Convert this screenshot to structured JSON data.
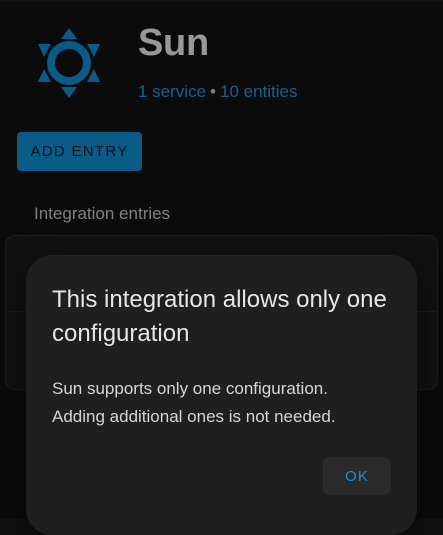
{
  "header": {
    "title": "Sun",
    "services_link": "1 service",
    "separator": "•",
    "entities_link": "10 entities",
    "logo_icon": "sun-icon"
  },
  "actions": {
    "add_entry_label": "ADD ENTRY"
  },
  "entries": {
    "section_title": "Integration entries"
  },
  "dialog": {
    "title": "This integration allows only one configuration",
    "body_line1": "Sun supports only one configuration.",
    "body_line2": "Adding additional ones is not needed.",
    "ok_label": "OK"
  },
  "colors": {
    "accent": "#0f86c6",
    "link": "#1f8fd6",
    "background": "#111111",
    "dialog_bg": "#1f1f1f"
  }
}
